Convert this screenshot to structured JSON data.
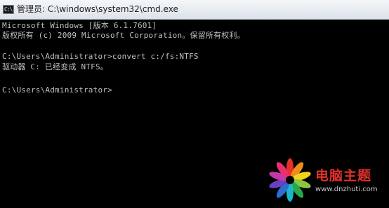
{
  "window": {
    "title": "管理员: C:\\windows\\system32\\cmd.exe",
    "icon_text": "C:\\"
  },
  "console": {
    "lines": [
      "Microsoft Windows [版本 6.1.7601]",
      "版权所有 (c) 2009 Microsoft Corporation。保留所有权利。",
      "",
      "C:\\Users\\Administrator>convert c:/fs:NTFS",
      "驱动器 C: 已经变成 NTFS。",
      "",
      "C:\\Users\\Administrator>"
    ]
  },
  "watermark": {
    "title": "电脑主题",
    "url": "www.dnzhuti.com"
  },
  "colors": {
    "console_background": "#000000",
    "console_text": "#c0c0c0",
    "watermark_title": "#e8302a"
  }
}
